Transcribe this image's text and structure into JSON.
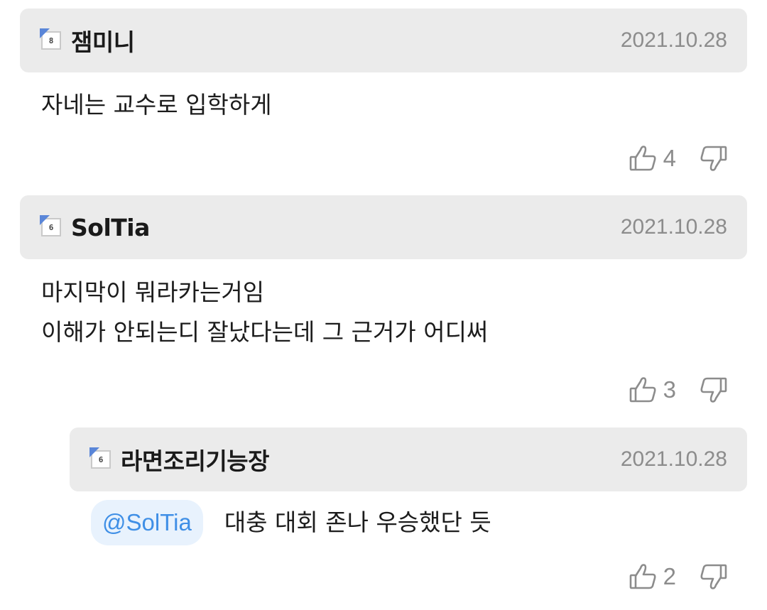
{
  "comments": [
    {
      "level": "8",
      "nickname": "잼미니",
      "date": "2021.10.28",
      "lines": [
        "자네는 교수로 입학하게"
      ],
      "likes": "4"
    },
    {
      "level": "6",
      "nickname": "SolTia",
      "date": "2021.10.28",
      "lines": [
        "마지막이 뭐라카는거임",
        "이해가 안되는디 잘났다는데 그 근거가 어디써"
      ],
      "likes": "3"
    }
  ],
  "reply": {
    "level": "6",
    "nickname": "라면조리기능장",
    "date": "2021.10.28",
    "mention": "@SolTia",
    "text": "대충 대회 존나 우승했단 듯",
    "likes": "2"
  },
  "icons": {
    "like": "thumbs-up-icon",
    "dislike": "thumbs-down-icon",
    "level": "level-badge-icon"
  },
  "colors": {
    "header_bg": "#ebebeb",
    "mention_text": "#3f8fe6",
    "mention_bg": "#e8f2fd",
    "muted": "#8c8c8c"
  }
}
